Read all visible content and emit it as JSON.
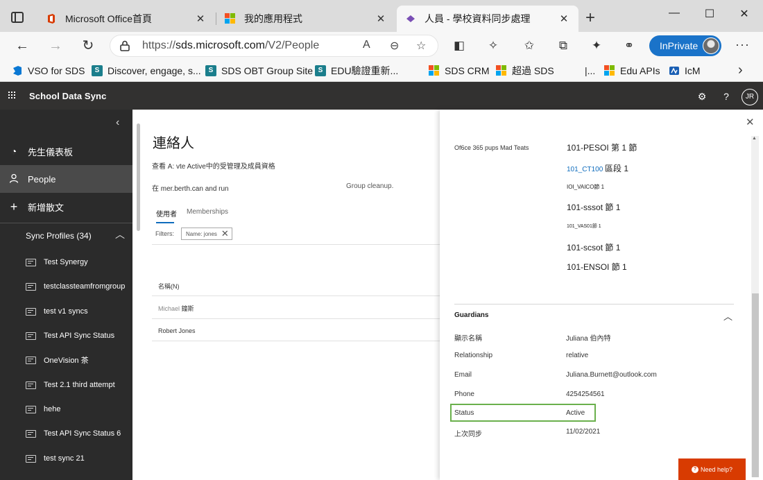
{
  "browser": {
    "tabs": [
      {
        "label": "Microsoft Office首頁",
        "close": "✕"
      },
      {
        "label": "我的應用程式",
        "close": "✕"
      },
      {
        "label": "人員 - 學校資料同步處理",
        "close": "✕"
      }
    ],
    "new_tab": "+",
    "window_controls": {
      "minimize": "—",
      "maximize": "☐",
      "close": "✕"
    },
    "address": {
      "scheme": "https://",
      "host": "sds.microsoft.com",
      "path": "/V2/People"
    },
    "inprivate_label": "InPrivate",
    "favorites": [
      {
        "label": "VSO for SDS",
        "icon": "vso-icon"
      },
      {
        "label": "Discover, engage, s...",
        "icon": "sharepoint-icon"
      },
      {
        "label": "SDS OBT Group Site",
        "icon": "sharepoint-icon"
      },
      {
        "label": "EDU驗證重新...",
        "icon": "sharepoint-icon"
      },
      {
        "label": "SDS CRM",
        "icon": "microsoft-logo-icon"
      },
      {
        "label": "超過 SDS",
        "icon": "microsoft-logo-icon"
      },
      {
        "label": "|...",
        "icon": ""
      },
      {
        "label": "Edu APIs",
        "icon": "microsoft-logo-icon"
      },
      {
        "label": "IcM",
        "icon": "icm-icon"
      }
    ]
  },
  "app": {
    "name": "School Data Sync",
    "user_initials": "JR"
  },
  "nav": {
    "items": [
      {
        "label": "先生儀表板",
        "icon": "dashboard-icon"
      },
      {
        "label": "People",
        "icon": "person-icon",
        "selected": true
      },
      {
        "label": "新增散文",
        "icon": "plus-icon"
      }
    ],
    "sync_profiles_label": "Sync Profiles (34)",
    "profiles": [
      "Test Synergy",
      "testclassteamfromgroup",
      "test v1 syncs",
      "Test API Sync Status",
      "OneVision 茶",
      "Test 2.1 third attempt",
      "hehe",
      "Test API Sync Status 6",
      "test sync 21"
    ]
  },
  "main": {
    "title": "連絡人",
    "description": "查看 A: vte Active中的受管理及成員資格",
    "run_text": "在 mer.berth.can and run",
    "cleanup_text": "Group cleanup.",
    "pivots": {
      "users": "使用者",
      "memberships": "Memberships"
    },
    "filters_label": "Filters:",
    "filter_chip": "Name: jones",
    "column_name": "名稱(N)",
    "rows": [
      {
        "first": "Michael",
        "second": "鐘斯"
      },
      {
        "first": "",
        "second": "Robert Jones"
      }
    ]
  },
  "panel": {
    "group_label": "Of6ce 365 pups Mad Teats",
    "sections": [
      {
        "text": "101-PESOI 第 1 節",
        "link": ""
      },
      {
        "text": "區段 1",
        "link": "101_CT100"
      },
      {
        "text": "IOI_VAICO節 1",
        "link": ""
      },
      {
        "text": "101-sssot 節 1",
        "link": ""
      },
      {
        "text": "101_VAS01節 1",
        "link": ""
      },
      {
        "text": "101-scsot 節 1",
        "link": ""
      },
      {
        "text": "101-ENSOI 節 1",
        "link": ""
      }
    ],
    "guardians": {
      "heading": "Guardians",
      "fields": [
        {
          "key": "顯示名稱",
          "value": "Juliana 伯內特"
        },
        {
          "key": "Relationship",
          "value": "relative"
        },
        {
          "key": "Email",
          "value": "Juliana.Burnett@outlook.com"
        },
        {
          "key": "Phone",
          "value": "4254254561"
        },
        {
          "key": "Status",
          "value": "Active"
        },
        {
          "key": "上次同步",
          "value": "11/02/2021"
        }
      ]
    },
    "need_help": "Need help?"
  },
  "colors": {
    "accent": "#0f6cbd",
    "app_header": "#323130",
    "nav_bg": "#2b2b2b",
    "nav_selected": "#4a4a4a",
    "highlight_green": "#6ab04c",
    "need_help": "#d83b01",
    "inprivate": "#1a73c9"
  }
}
